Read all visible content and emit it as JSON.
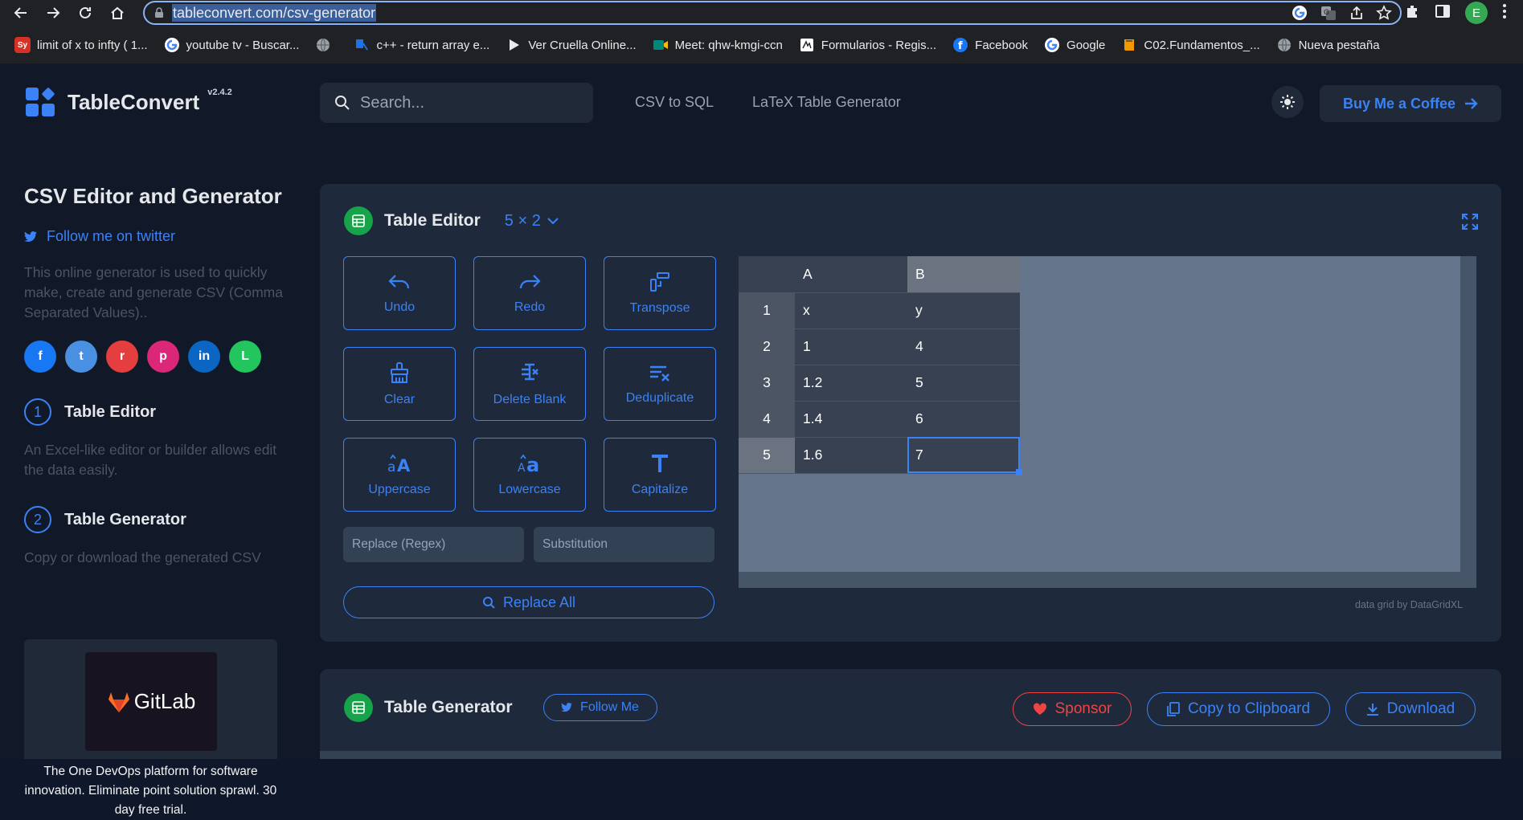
{
  "browser": {
    "url": "tableconvert.com/csv-generator",
    "avatar_letter": "E",
    "bookmarks": [
      {
        "label": "limit of x to infty ( 1...",
        "icon": "symbolab-icon",
        "badge": "Sy",
        "color": "#d93025"
      },
      {
        "label": "youtube tv - Buscar...",
        "icon": "google-icon",
        "color": "#ffffff"
      },
      {
        "label": "",
        "icon": "globe-icon",
        "color": "#5f6368"
      },
      {
        "label": "c++ - return array e...",
        "icon": "stackoverflow-icon",
        "color": "#1a73e8"
      },
      {
        "label": "Ver Cruella Online...",
        "icon": "play-icon",
        "color": "#202124"
      },
      {
        "label": "Meet: qhw-kmgi-ccn",
        "icon": "meet-icon",
        "color": "#00897b"
      },
      {
        "label": "Formularios - Regis...",
        "icon": "forms-icon",
        "color": "#ffffff"
      },
      {
        "label": "Facebook",
        "icon": "facebook-icon",
        "color": "#1877f2"
      },
      {
        "label": "Google",
        "icon": "google-icon",
        "color": "#ffffff"
      },
      {
        "label": "C02.Fundamentos_...",
        "icon": "book-icon",
        "color": "#f29900"
      },
      {
        "label": "Nueva pestaña",
        "icon": "globe-icon",
        "color": "#5f6368"
      }
    ]
  },
  "header": {
    "brand": "TableConvert",
    "version": "v2.4.2",
    "search_placeholder": "Search...",
    "links": [
      "CSV to SQL",
      "LaTeX Table Generator"
    ],
    "coffee_label": "Buy Me a Coffee"
  },
  "sidebar": {
    "title": "CSV Editor and Generator",
    "twitter": "Follow me on twitter",
    "description": "This online generator is used to quickly make, create and generate CSV (Comma Separated Values)..",
    "social": [
      {
        "name": "facebook-share-icon",
        "glyph": "f",
        "color": "#1877f2"
      },
      {
        "name": "twitter-share-icon",
        "glyph": "t",
        "color": "#4a90e2"
      },
      {
        "name": "reddit-share-icon",
        "glyph": "r",
        "color": "#e53e3e"
      },
      {
        "name": "pinterest-share-icon",
        "glyph": "p",
        "color": "#db2777"
      },
      {
        "name": "linkedin-share-icon",
        "glyph": "in",
        "color": "#0a66c2"
      },
      {
        "name": "line-share-icon",
        "glyph": "L",
        "color": "#22c55e"
      }
    ],
    "steps": [
      {
        "num": "1",
        "label": "Table Editor",
        "desc": "An Excel-like editor or builder allows edit the data easily."
      },
      {
        "num": "2",
        "label": "Table Generator",
        "desc": "Copy or download the generated CSV"
      }
    ],
    "ad": {
      "brand": "GitLab",
      "text": "The One DevOps platform for software innovation. Eliminate point solution sprawl. 30 day free trial."
    }
  },
  "editor": {
    "title": "Table Editor",
    "size": "5 × 2",
    "tools": [
      {
        "name": "undo-button",
        "icon": "undo-icon",
        "label": "Undo"
      },
      {
        "name": "redo-button",
        "icon": "redo-icon",
        "label": "Redo"
      },
      {
        "name": "transpose-button",
        "icon": "transpose-icon",
        "label": "Transpose"
      },
      {
        "name": "clear-button",
        "icon": "broom-icon",
        "label": "Clear"
      },
      {
        "name": "delete-blank-button",
        "icon": "delete-blank-icon",
        "label": "Delete Blank"
      },
      {
        "name": "deduplicate-button",
        "icon": "deduplicate-icon",
        "label": "Deduplicate"
      },
      {
        "name": "uppercase-button",
        "icon": "uppercase-icon",
        "label": "Uppercase"
      },
      {
        "name": "lowercase-button",
        "icon": "lowercase-icon",
        "label": "Lowercase"
      },
      {
        "name": "capitalize-button",
        "icon": "capitalize-icon",
        "label": "Capitalize"
      }
    ],
    "replace_placeholder": "Replace (Regex)",
    "substitution_placeholder": "Substitution",
    "replace_all": "Replace All",
    "grid": {
      "columns": [
        "A",
        "B"
      ],
      "rows": [
        {
          "num": "1",
          "cells": [
            "x",
            "y"
          ]
        },
        {
          "num": "2",
          "cells": [
            "1",
            "4"
          ]
        },
        {
          "num": "3",
          "cells": [
            "1.2",
            "5"
          ]
        },
        {
          "num": "4",
          "cells": [
            "1.4",
            "6"
          ]
        },
        {
          "num": "5",
          "cells": [
            "1.6",
            "7"
          ]
        }
      ],
      "active_cell": {
        "row": 5,
        "col": "B"
      }
    },
    "credit": "data grid by DataGridXL"
  },
  "generator": {
    "title": "Table Generator",
    "follow": "Follow Me",
    "sponsor": "Sponsor",
    "copy": "Copy to Clipboard",
    "download": "Download"
  }
}
